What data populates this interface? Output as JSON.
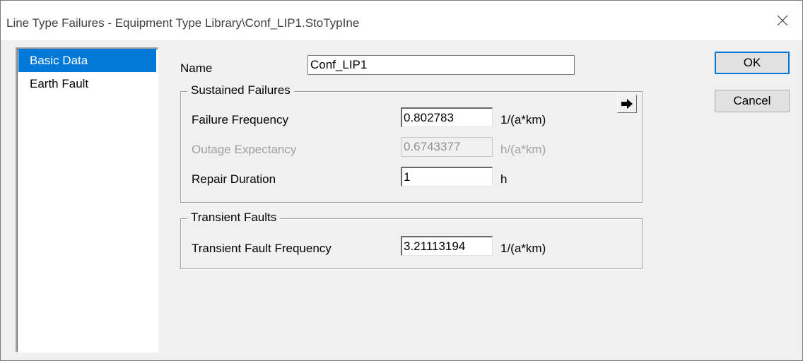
{
  "window": {
    "title": "Line Type Failures - Equipment Type Library\\Conf_LIP1.StoTypIne"
  },
  "sidebar": {
    "items": [
      {
        "label": "Basic Data",
        "selected": true
      },
      {
        "label": "Earth Fault",
        "selected": false
      }
    ]
  },
  "form": {
    "name_label": "Name",
    "name_value": "Conf_LIP1",
    "sustained": {
      "title": "Sustained Failures",
      "failure_frequency": {
        "label": "Failure Frequency",
        "value": "0.802783",
        "unit": "1/(a*km)"
      },
      "outage_expectancy": {
        "label": "Outage Expectancy",
        "value": "0.6743377",
        "unit": "h/(a*km)"
      },
      "repair_duration": {
        "label": "Repair Duration",
        "value": "1",
        "unit": "h"
      }
    },
    "transient": {
      "title": "Transient Faults",
      "frequency": {
        "label": "Transient Fault Frequency",
        "value": "3.21113194",
        "unit": "1/(a*km)"
      }
    }
  },
  "buttons": {
    "ok": "OK",
    "cancel": "Cancel"
  },
  "colors": {
    "selection": "#0078d7",
    "disabled_text": "#a0a0a0"
  }
}
